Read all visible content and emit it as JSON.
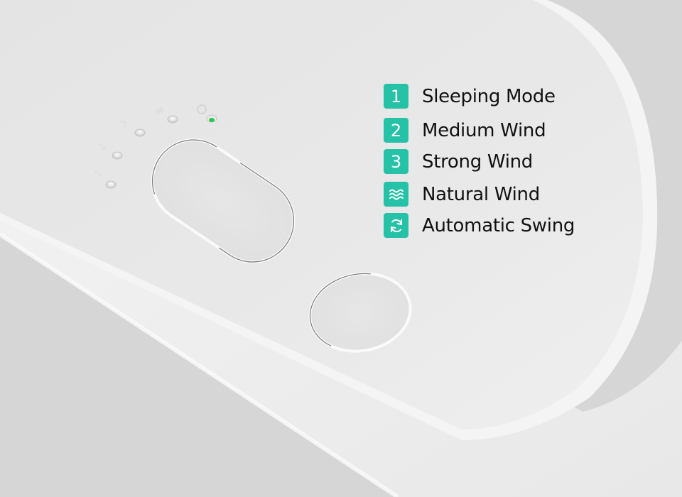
{
  "image": {
    "subject": "White fan control panel with two buttons and indicator lights",
    "colors": {
      "accent": "#26c2a7",
      "indicator_active": "#22cc44",
      "body": "#e6e6e6",
      "text": "#111111"
    }
  },
  "indicators": [
    {
      "mark": "1",
      "icon": "level-1",
      "active": false
    },
    {
      "mark": "2",
      "icon": "level-2",
      "active": false
    },
    {
      "mark": "3",
      "icon": "level-3",
      "active": false
    },
    {
      "mark": "≋",
      "icon": "natural-wind-icon",
      "active": false
    },
    {
      "mark": "◌",
      "icon": "swing-icon",
      "active": true
    }
  ],
  "legend": {
    "items": [
      {
        "badge": "1",
        "icon": "number",
        "label": "Sleeping Mode"
      },
      {
        "badge": "2",
        "icon": "number",
        "label": "Medium Wind"
      },
      {
        "badge": "3",
        "icon": "number",
        "label": "Strong Wind"
      },
      {
        "badge": "",
        "icon": "waves-icon",
        "label": "Natural Wind"
      },
      {
        "badge": "",
        "icon": "rotate-icon",
        "label": "Automatic Swing"
      }
    ]
  }
}
